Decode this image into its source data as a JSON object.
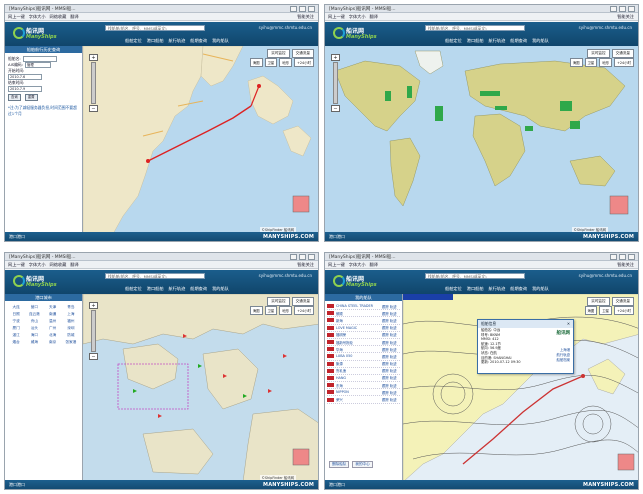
{
  "colors": {
    "header": "#1b5e8c",
    "logo_green": "#8fd14f",
    "route_red": "#d22",
    "water": "#b8d8ee",
    "land": "#eee7c8"
  },
  "browser": {
    "title": "[ManyShips]船讯网 - MMSI船...",
    "menu": [
      "网上一键",
      "字体大小",
      "网络收藏",
      "查看历史",
      "翻译"
    ],
    "menu_right": "智能关注"
  },
  "site": {
    "logo_cn": "船讯网",
    "logo_en": "ManyShips",
    "user": "syihu@mmc.shmtu.edu.cn",
    "search_placeholder": "找船舶(船名、呼号、MMSI或英文)",
    "nav": [
      "船舶定位",
      "港口船舶",
      "航行轨迹",
      "船期查询",
      "我的船队"
    ],
    "footer_left": "港口港口",
    "footer_right": "MANYSHIPS.COM"
  },
  "map_controls": {
    "buttons": [
      "实时监控",
      "交通流量",
      "地图"
    ],
    "sub_buttons": [
      "海图",
      "卫星",
      "地形",
      "国内",
      "+24小时"
    ],
    "logo": "©ShipFinder 船讯网"
  },
  "panel_track": {
    "header": "船舶航行历史查询",
    "fields": [
      {
        "label": "船舶名:",
        "value": ""
      },
      {
        "label": "AIS编码:",
        "value": "管理"
      },
      {
        "label": "开始时间:",
        "value": "2010.7.6"
      },
      {
        "label": "结束时间:",
        "value": "2010.7.9"
      }
    ],
    "buttons": [
      "查询",
      "重置"
    ],
    "note": "*注:为了减轻服务器负担,时间范围不要超过1个月"
  },
  "panel_ports": {
    "header": "港口城市",
    "cities": [
      "大连",
      "营口",
      "天津",
      "青岛",
      "日照",
      "连云港",
      "南通",
      "上海",
      "宁波",
      "舟山",
      "温州",
      "福州",
      "厦门",
      "汕头",
      "广州",
      "深圳",
      "湛江",
      "海口",
      "北海",
      "防城",
      "烟台",
      "威海",
      "南京",
      "张家港"
    ]
  },
  "panel_ships": {
    "header": "我的船队",
    "ships": [
      {
        "name": "CHINA STEEL TRADER",
        "actions": "跟踪 轨迹"
      },
      {
        "name": "朗顺",
        "actions": "跟踪 轨迹"
      },
      {
        "name": "新海",
        "actions": "跟踪 轨迹"
      },
      {
        "name": "LOVE MAGIC",
        "actions": "跟踪 轨迹"
      },
      {
        "name": "福明荣",
        "actions": "跟踪 轨迹"
      },
      {
        "name": "福新号拖轮",
        "actions": "跟踪 轨迹"
      },
      {
        "name": "华海",
        "actions": "跟踪 轨迹"
      },
      {
        "name": "LUBA 050",
        "actions": "跟踪 轨迹"
      },
      {
        "name": "聚源",
        "actions": "跟踪 轨迹"
      },
      {
        "name": "鲁乳渔",
        "actions": "跟踪 轨迹"
      },
      {
        "name": "HANG",
        "actions": "跟踪 轨迹"
      },
      {
        "name": "东海",
        "actions": "跟踪 轨迹"
      },
      {
        "name": "NIPPON",
        "actions": "跟踪 轨迹"
      },
      {
        "name": "荣兴",
        "actions": "跟踪 轨迹"
      }
    ],
    "buttons": [
      "删除船队",
      "我的中心"
    ]
  },
  "popup": {
    "title": "船舶信息",
    "rows": [
      "船舶名: 中远",
      "呼号: BKNM",
      "MMSI: 412",
      "航速: 12.1节",
      "航向: 56.9度",
      "状态: 在航",
      "目的港: SHANGHAI",
      "更新: 2010-07-12 09:30"
    ],
    "logo": "船讯网",
    "links": [
      "上海港",
      "航行轨迹",
      "船舶档案"
    ]
  }
}
